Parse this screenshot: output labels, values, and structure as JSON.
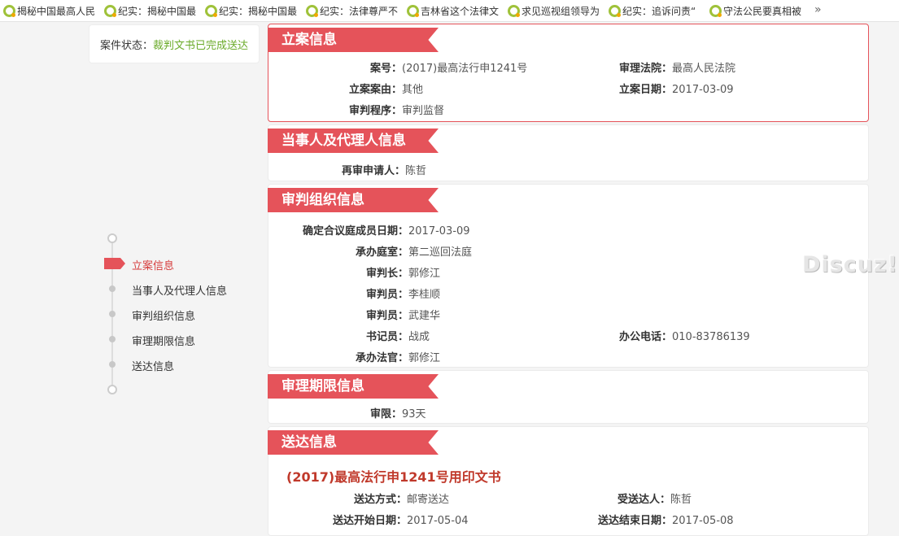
{
  "topbar": {
    "items": [
      "揭秘中国最高人民",
      "纪实：揭秘中国最",
      "纪实：揭秘中国最",
      "纪实：法律尊严不",
      "吉林省这个法律文",
      "求见巡视组领导为",
      "纪实：追诉问责“",
      "守法公民要真相被"
    ],
    "more": "»"
  },
  "status": {
    "label": "案件状态：",
    "value": "裁判文书已完成送达"
  },
  "nav": {
    "items": [
      "立案信息",
      "当事人及代理人信息",
      "审判组织信息",
      "审理期限信息",
      "送达信息"
    ],
    "active_index": 0
  },
  "sections": {
    "filing": {
      "title": "立案信息",
      "case_no_label": "案号：",
      "case_no": "(2017)最高法行申1241号",
      "court_label": "审理法院：",
      "court": "最高人民法院",
      "cause_label": "立案案由：",
      "cause": "其他",
      "date_label": "立案日期：",
      "date": "2017-03-09",
      "procedure_label": "审判程序：",
      "procedure": "审判监督"
    },
    "parties": {
      "title": "当事人及代理人信息",
      "applicant_label": "再审申请人：",
      "applicant": "陈哲"
    },
    "tribunal": {
      "title": "审判组织信息",
      "rows": [
        {
          "label": "确定合议庭成员日期：",
          "value": "2017-03-09"
        },
        {
          "label": "承办庭室：",
          "value": "第二巡回法庭"
        },
        {
          "label": "审判长：",
          "value": "郭修江"
        },
        {
          "label": "审判员：",
          "value": "李桂顺"
        },
        {
          "label": "审判员：",
          "value": "武建华"
        },
        {
          "label": "书记员：",
          "value": "战成"
        },
        {
          "label": "承办法官：",
          "value": "郭修江"
        }
      ],
      "phone_label": "办公电话：",
      "phone": "010-83786139"
    },
    "term": {
      "title": "审理期限信息",
      "limit_label": "审限：",
      "limit": "93天"
    },
    "delivery": {
      "title": "送达信息",
      "doc_title": "(2017)最高法行申1241号用印文书",
      "method_label": "送达方式：",
      "method": "邮寄送达",
      "recipient_label": "受送达人：",
      "recipient": "陈哲",
      "start_label": "送达开始日期：",
      "start": "2017-05-04",
      "end_label": "送达结束日期：",
      "end": "2017-05-08"
    }
  },
  "watermark": "Discuz!",
  "colors": {
    "accent": "#e5535a",
    "status_green": "#6bab2a",
    "ring_green": "#9fc23a"
  }
}
